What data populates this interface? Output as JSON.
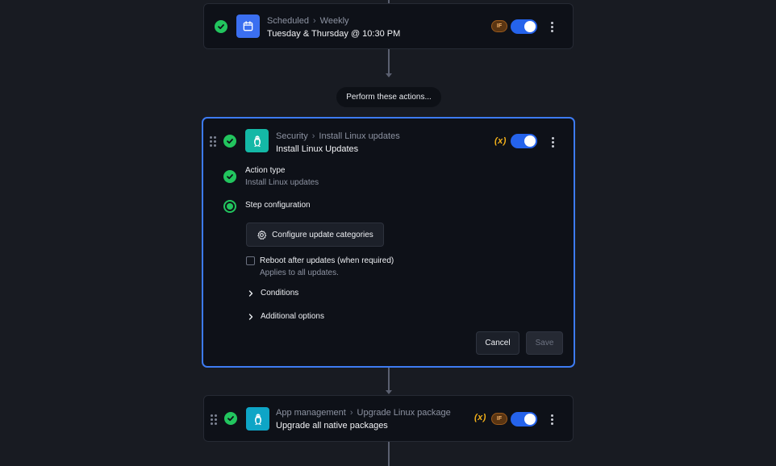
{
  "trigger": {
    "breadcrumb": [
      "Scheduled",
      "Weekly"
    ],
    "title": "Tuesday & Thursday @ 10:30 PM",
    "badge_if": "IF",
    "enabled": true
  },
  "divider_pill": "Perform these actions...",
  "action_card": {
    "breadcrumb": [
      "Security",
      "Install Linux updates"
    ],
    "title": "Install Linux Updates",
    "var_badge": "(x)",
    "enabled": true,
    "action_type_label": "Action type",
    "action_type_value": "Install Linux updates",
    "step_config_label": "Step configuration",
    "configure_button": "Configure update categories",
    "reboot_label": "Reboot after updates (when required)",
    "reboot_hint": "Applies to all updates.",
    "reboot_checked": false,
    "conditions_label": "Conditions",
    "additional_options_label": "Additional options",
    "cancel_label": "Cancel",
    "save_label": "Save"
  },
  "app_card": {
    "breadcrumb": [
      "App management",
      "Upgrade Linux package"
    ],
    "title": "Upgrade all native packages",
    "var_badge": "(x)",
    "badge_if": "IF",
    "enabled": true
  },
  "colors": {
    "accent": "#2563eb",
    "success": "#22c55e",
    "active_border": "#3d7bf2",
    "var_badge": "#f5b21a"
  },
  "icons": {
    "trigger_app": "calendar-icon",
    "action_app": "linux-penguin-icon",
    "app_mgmt_app": "linux-penguin-icon",
    "status": "check-icon",
    "menu": "more-vertical-icon",
    "drag": "drag-handle-icon",
    "configure": "gear-icon",
    "expander": "chevron-right-icon"
  }
}
